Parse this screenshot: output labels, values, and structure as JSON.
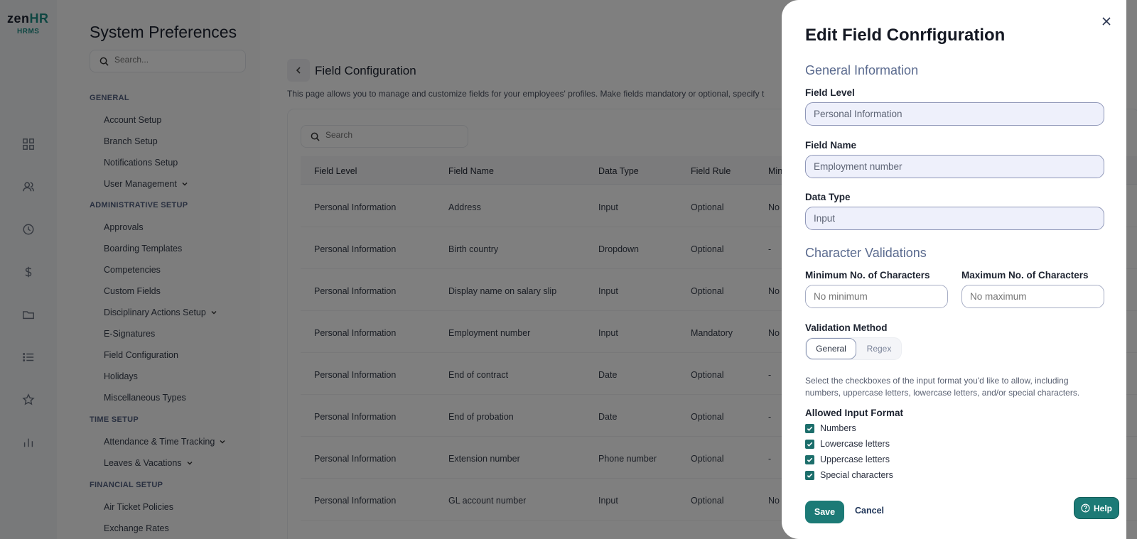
{
  "brand": {
    "logo_main": "zen",
    "logo_accent": "HR",
    "logo_sub": "HRMS",
    "accent_color": "#1c8d84"
  },
  "rail_icons": [
    "dashboard-icon",
    "people-icon",
    "clock-icon",
    "dollar-icon",
    "folder-icon",
    "list-icon",
    "star-icon",
    "bar-chart-icon"
  ],
  "settings": {
    "title": "System Preferences",
    "search_placeholder": "Search...",
    "sections": [
      {
        "title": "GENERAL",
        "items": [
          {
            "label": "Account Setup",
            "has_chevron": false
          },
          {
            "label": "Branch Setup",
            "has_chevron": false
          },
          {
            "label": "Notifications Setup",
            "has_chevron": false
          },
          {
            "label": "User Management",
            "has_chevron": true
          }
        ]
      },
      {
        "title": "ADMINISTRATIVE SETUP",
        "items": [
          {
            "label": "Approvals",
            "has_chevron": false
          },
          {
            "label": "Boarding Templates",
            "has_chevron": false
          },
          {
            "label": "Competencies",
            "has_chevron": false
          },
          {
            "label": "Custom Fields",
            "has_chevron": false
          },
          {
            "label": "Disciplinary Actions Setup",
            "has_chevron": true
          },
          {
            "label": "E-Signatures",
            "has_chevron": false
          },
          {
            "label": "Field Configuration",
            "has_chevron": false
          },
          {
            "label": "Holidays",
            "has_chevron": false
          },
          {
            "label": "Miscellaneous Types",
            "has_chevron": false
          }
        ]
      },
      {
        "title": "TIME SETUP",
        "items": [
          {
            "label": "Attendance & Time Tracking",
            "has_chevron": true
          },
          {
            "label": "Leaves & Vacations",
            "has_chevron": true
          }
        ]
      },
      {
        "title": "FINANCIAL SETUP",
        "items": [
          {
            "label": "Air Ticket Policies",
            "has_chevron": false
          },
          {
            "label": "Exchange Rates",
            "has_chevron": false
          }
        ]
      }
    ]
  },
  "main": {
    "title": "Field Configuration",
    "description": "This page allows you to manage and customize fields for your employees' profiles. Make fields mandatory or optional, specify t",
    "search_placeholder": "Search",
    "columns": [
      "Field Level",
      "Field Name",
      "Data Type",
      "Field Rule",
      "Mini"
    ],
    "rows": [
      [
        "Personal Information",
        "Address",
        "Input",
        "Optional",
        "No r"
      ],
      [
        "Personal Information",
        "Birth country",
        "Dropdown",
        "Optional",
        "-"
      ],
      [
        "Personal Information",
        "Display name on salary slip",
        "Input",
        "Optional",
        "No r"
      ],
      [
        "Personal Information",
        "Employment number",
        "Input",
        "Mandatory",
        "No r"
      ],
      [
        "Personal Information",
        "End of contract",
        "Date",
        "Optional",
        "-"
      ],
      [
        "Personal Information",
        "End of probation",
        "Date",
        "Optional",
        "-"
      ],
      [
        "Personal Information",
        "Extension number",
        "Phone number",
        "Optional",
        "-"
      ],
      [
        "Personal Information",
        "GL account number",
        "Input",
        "Optional",
        "No r"
      ]
    ]
  },
  "modal": {
    "title": "Edit Field Conrfiguration",
    "general_title": "General Information",
    "field_level_label": "Field Level",
    "field_level_value": "Personal Information",
    "field_name_label": "Field Name",
    "field_name_value": "Employment number",
    "data_type_label": "Data Type",
    "data_type_value": "Input",
    "validations_title": "Character Validations",
    "min_label": "Minimum No. of Characters",
    "min_placeholder": "No minimum",
    "max_label": "Maximum No. of Characters",
    "max_placeholder": "No maximum",
    "method_label": "Validation Method",
    "method_options": [
      "General",
      "Regex"
    ],
    "method_selected": "General",
    "helper_text": "Select the checkboxes of the input format you'd like to allow, including numbers, uppercase letters, lowercase letters, and/or special characters.",
    "formats_label": "Allowed Input Format",
    "formats": [
      {
        "label": "Numbers",
        "checked": true
      },
      {
        "label": "Lowercase letters",
        "checked": true
      },
      {
        "label": "Uppercase letters",
        "checked": true
      },
      {
        "label": "Special characters",
        "checked": true
      }
    ],
    "save_label": "Save",
    "cancel_label": "Cancel"
  },
  "help_label": "Help"
}
